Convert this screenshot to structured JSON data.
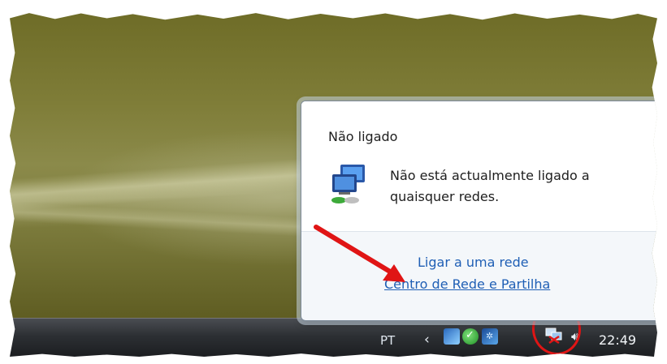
{
  "popup": {
    "title": "Não ligado",
    "message": "Não está actualmente ligado a quaisquer redes.",
    "links": {
      "connect": "Ligar a uma rede",
      "network_center": "Centro de Rede e Partilha"
    },
    "icon": "network-disconnected-icon"
  },
  "taskbar": {
    "language": "PT",
    "show_hidden_icon": "‹",
    "clock": "22:49",
    "tray_icons": [
      "network-status-icon",
      "security-check-icon",
      "bluetooth-icon",
      "network-disconnected-tray-icon",
      "volume-icon"
    ]
  },
  "annotations": {
    "color": "#e01515"
  }
}
